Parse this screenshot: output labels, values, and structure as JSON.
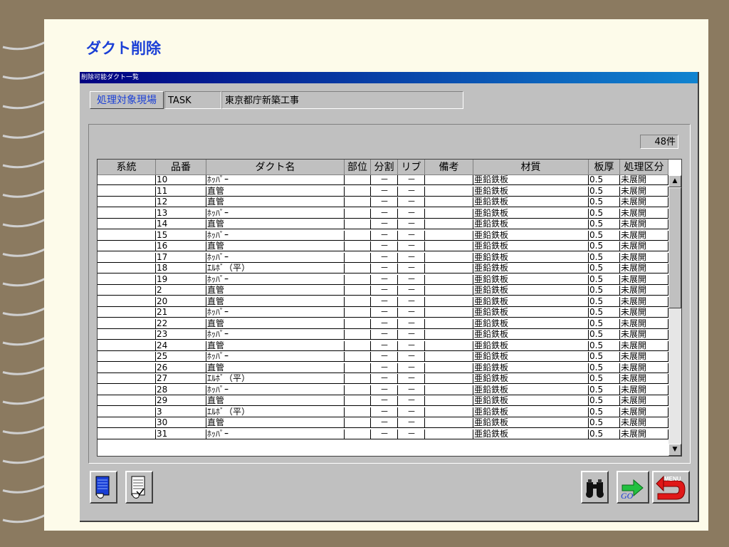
{
  "page": {
    "title": "ダクト削除"
  },
  "window": {
    "title": "削除可能ダクト一覧"
  },
  "site": {
    "button_label": "処理対象現場",
    "code": "TASK",
    "name": "東京都庁新築工事"
  },
  "count_label": "48件",
  "columns": [
    "系統",
    "品番",
    "ダクト名",
    "部位",
    "分割",
    "リブ",
    "備考",
    "材質",
    "板厚",
    "処理区分"
  ],
  "rows": [
    [
      "",
      "10",
      "ﾎｯﾊﾟｰ",
      "",
      "－",
      "－",
      "",
      "亜鉛鉄板",
      "0.5",
      "未展開"
    ],
    [
      "",
      "11",
      "直管",
      "",
      "－",
      "－",
      "",
      "亜鉛鉄板",
      "0.5",
      "未展開"
    ],
    [
      "",
      "12",
      "直管",
      "",
      "－",
      "－",
      "",
      "亜鉛鉄板",
      "0.5",
      "未展開"
    ],
    [
      "",
      "13",
      "ﾎｯﾊﾟｰ",
      "",
      "－",
      "－",
      "",
      "亜鉛鉄板",
      "0.5",
      "未展開"
    ],
    [
      "",
      "14",
      "直管",
      "",
      "－",
      "－",
      "",
      "亜鉛鉄板",
      "0.5",
      "未展開"
    ],
    [
      "",
      "15",
      "ﾎｯﾊﾟｰ",
      "",
      "－",
      "－",
      "",
      "亜鉛鉄板",
      "0.5",
      "未展開"
    ],
    [
      "",
      "16",
      "直管",
      "",
      "－",
      "－",
      "",
      "亜鉛鉄板",
      "0.5",
      "未展開"
    ],
    [
      "",
      "17",
      "ﾎｯﾊﾟｰ",
      "",
      "－",
      "－",
      "",
      "亜鉛鉄板",
      "0.5",
      "未展開"
    ],
    [
      "",
      "18",
      "ｴﾙﾎﾞ（平）",
      "",
      "－",
      "－",
      "",
      "亜鉛鉄板",
      "0.5",
      "未展開"
    ],
    [
      "",
      "19",
      "ﾎｯﾊﾟｰ",
      "",
      "－",
      "－",
      "",
      "亜鉛鉄板",
      "0.5",
      "未展開"
    ],
    [
      "",
      "2",
      "直管",
      "",
      "－",
      "－",
      "",
      "亜鉛鉄板",
      "0.5",
      "未展開"
    ],
    [
      "",
      "20",
      "直管",
      "",
      "－",
      "－",
      "",
      "亜鉛鉄板",
      "0.5",
      "未展開"
    ],
    [
      "",
      "21",
      "ﾎｯﾊﾟｰ",
      "",
      "－",
      "－",
      "",
      "亜鉛鉄板",
      "0.5",
      "未展開"
    ],
    [
      "",
      "22",
      "直管",
      "",
      "－",
      "－",
      "",
      "亜鉛鉄板",
      "0.5",
      "未展開"
    ],
    [
      "",
      "23",
      "ﾎｯﾊﾟｰ",
      "",
      "－",
      "－",
      "",
      "亜鉛鉄板",
      "0.5",
      "未展開"
    ],
    [
      "",
      "24",
      "直管",
      "",
      "－",
      "－",
      "",
      "亜鉛鉄板",
      "0.5",
      "未展開"
    ],
    [
      "",
      "25",
      "ﾎｯﾊﾟｰ",
      "",
      "－",
      "－",
      "",
      "亜鉛鉄板",
      "0.5",
      "未展開"
    ],
    [
      "",
      "26",
      "直管",
      "",
      "－",
      "－",
      "",
      "亜鉛鉄板",
      "0.5",
      "未展開"
    ],
    [
      "",
      "27",
      "ｴﾙﾎﾞ（平）",
      "",
      "－",
      "－",
      "",
      "亜鉛鉄板",
      "0.5",
      "未展開"
    ],
    [
      "",
      "28",
      "ﾎｯﾊﾟｰ",
      "",
      "－",
      "－",
      "",
      "亜鉛鉄板",
      "0.5",
      "未展開"
    ],
    [
      "",
      "29",
      "直管",
      "",
      "－",
      "－",
      "",
      "亜鉛鉄板",
      "0.5",
      "未展開"
    ],
    [
      "",
      "3",
      "ｴﾙﾎﾞ（平）",
      "",
      "－",
      "－",
      "",
      "亜鉛鉄板",
      "0.5",
      "未展開"
    ],
    [
      "",
      "30",
      "直管",
      "",
      "－",
      "－",
      "",
      "亜鉛鉄板",
      "0.5",
      "未展開"
    ],
    [
      "",
      "31",
      "ﾎｯﾊﾟｰ",
      "",
      "－",
      "－",
      "",
      "亜鉛鉄板",
      "0.5",
      "未展開"
    ]
  ],
  "buttons": {
    "select_all_icon": "list-select-all-icon",
    "select_check_icon": "list-check-icon",
    "search_icon": "binoculars-icon",
    "go_label": "GO",
    "menu_label": "MENU"
  },
  "colors": {
    "title": "#1a3fd6",
    "titlebar": "#000080",
    "paper": "#fdfbea",
    "background": "#8b7a60"
  }
}
